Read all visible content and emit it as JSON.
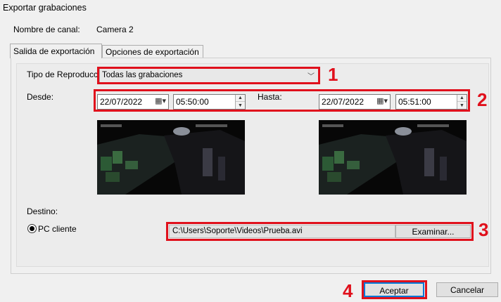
{
  "window": {
    "title": "Exportar grabaciones"
  },
  "channel": {
    "label": "Nombre de canal:",
    "value": "Camera 2"
  },
  "tabs": [
    {
      "label": "Salida de exportación",
      "active": true
    },
    {
      "label": "Opciones de exportación",
      "active": false
    }
  ],
  "playback": {
    "label": "Tipo de Reproducción",
    "value": "Todas las grabaciones"
  },
  "from": {
    "label": "Desde:",
    "date": "22/07/2022",
    "time": "05:50:00"
  },
  "to": {
    "label": "Hasta:",
    "date": "22/07/2022",
    "time": "05:51:00"
  },
  "destination": {
    "label": "Destino:",
    "option": "PC cliente",
    "path": "C:\\Users\\Soporte\\Videos\\Prueba.avi",
    "browse_label": "Examinar..."
  },
  "buttons": {
    "ok": "Aceptar",
    "cancel": "Cancelar"
  },
  "callouts": [
    "1",
    "2",
    "3",
    "4"
  ],
  "colors": {
    "callout": "#e0101c",
    "focus": "#0078d7"
  }
}
